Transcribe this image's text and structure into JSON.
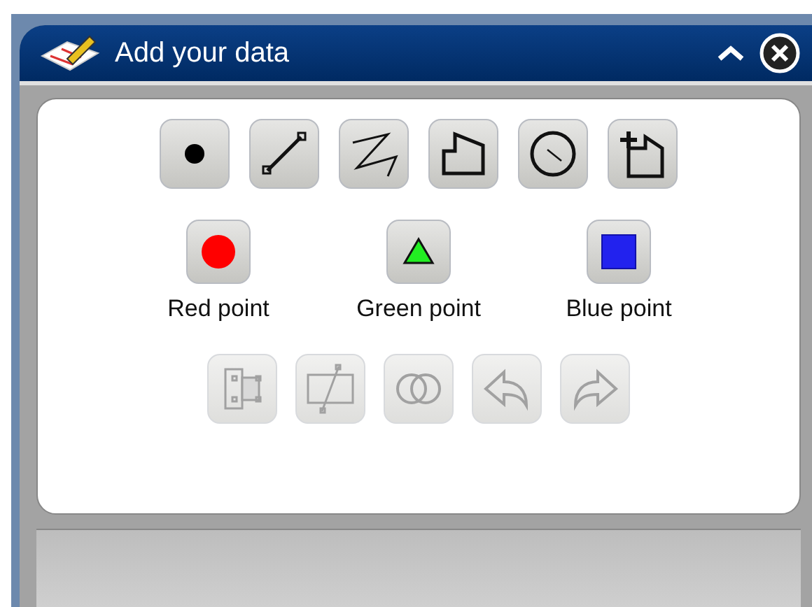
{
  "window": {
    "title": "Add your data"
  },
  "tools": [
    {
      "kind": "point",
      "disabled": false
    },
    {
      "kind": "line",
      "disabled": false
    },
    {
      "kind": "polyline",
      "disabled": false
    },
    {
      "kind": "polygon",
      "disabled": false
    },
    {
      "kind": "circle",
      "disabled": false
    },
    {
      "kind": "addpolygon",
      "disabled": false
    }
  ],
  "points": [
    {
      "label": "Red point",
      "kind": "circle",
      "color": "#ff0000"
    },
    {
      "label": "Green point",
      "kind": "triangle",
      "color": "#22ee22"
    },
    {
      "label": "Blue point",
      "kind": "square",
      "color": "#2222ee"
    }
  ],
  "edit_tools": [
    {
      "kind": "reshape",
      "disabled": true
    },
    {
      "kind": "cut",
      "disabled": true
    },
    {
      "kind": "union",
      "disabled": true
    },
    {
      "kind": "undo",
      "disabled": true
    },
    {
      "kind": "redo",
      "disabled": true
    }
  ]
}
